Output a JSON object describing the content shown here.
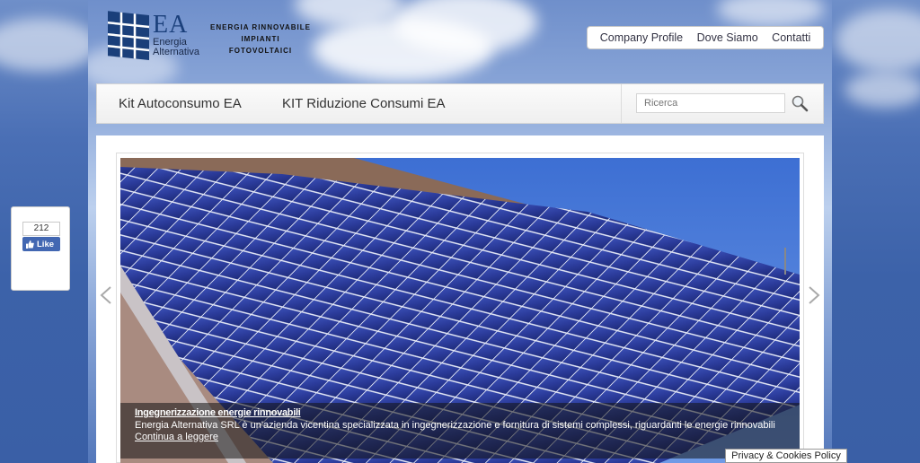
{
  "logo": {
    "mark": "EA",
    "line1": "Energia",
    "line2": "Alternativa",
    "tagline": [
      "ENERGIA RINNOVABILE",
      "IMPIANTI",
      "FOTOVOLTAICI"
    ]
  },
  "topnav": {
    "items": [
      "Company Profile",
      "Dove Siamo",
      "Contatti"
    ]
  },
  "menu": {
    "items": [
      "Kit Autoconsumo EA",
      "KIT Riduzione Consumi EA"
    ]
  },
  "search": {
    "placeholder": "Ricerca",
    "icon": "magnifier-icon"
  },
  "slider": {
    "prev_icon": "chevron-left-icon",
    "next_icon": "chevron-right-icon",
    "caption": {
      "title": "Ingegnerizzazione energie rinnovabili",
      "text": "Energia Alternativa SRL è un'azienda vicentina specializzata in ingegnerizzazione e fornitura di sistemi complessi, riguardanti le energie rinnovabili",
      "link": "Continua a leggere"
    }
  },
  "facebook": {
    "count": "212",
    "like_label": "Like",
    "icon": "thumbs-up-icon"
  },
  "privacy": {
    "label": "Privacy & Cookies Policy"
  },
  "colors": {
    "brand_blue": "#1a3f7a",
    "facebook_blue": "#4267b2",
    "sky_blue": "#3c62a9"
  }
}
